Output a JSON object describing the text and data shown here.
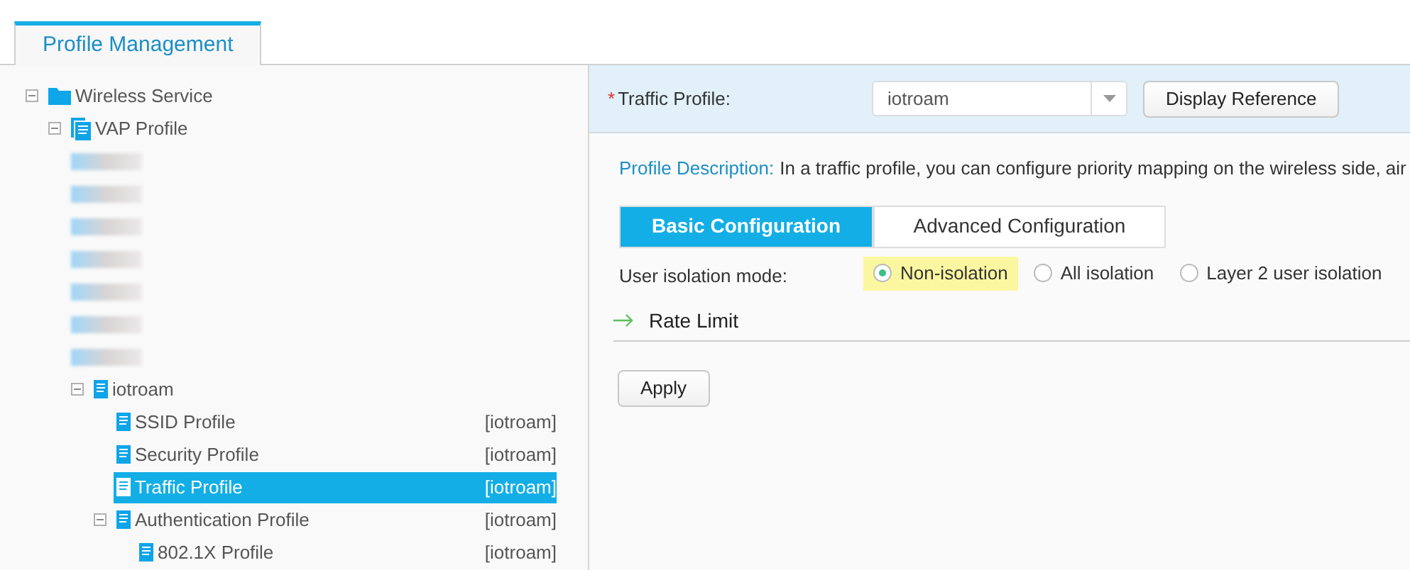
{
  "tabs": [
    {
      "label": "Profile Management",
      "selected": true
    }
  ],
  "tree": [
    {
      "label": "Wireless Service",
      "kind": "folder",
      "expanded": true,
      "selected": false,
      "children": [
        {
          "label": "VAP Profile",
          "kind": "stack",
          "expanded": true,
          "selected": false,
          "children": [
            {
              "kind": "blurred"
            },
            {
              "kind": "blurred"
            },
            {
              "kind": "blurred"
            },
            {
              "kind": "blurred"
            },
            {
              "kind": "blurred"
            },
            {
              "kind": "blurred"
            },
            {
              "kind": "blurred"
            },
            {
              "label": "iotroam",
              "kind": "doc",
              "expanded": true,
              "selected": false,
              "children": [
                {
                  "label": "SSID Profile",
                  "kind": "doc",
                  "suffix": "[iotroam]",
                  "selected": false
                },
                {
                  "label": "Security Profile",
                  "kind": "doc",
                  "suffix": "[iotroam]",
                  "selected": false
                },
                {
                  "label": "Traffic Profile",
                  "kind": "doc",
                  "suffix": "[iotroam]",
                  "selected": true
                },
                {
                  "label": "Authentication Profile",
                  "kind": "doc",
                  "suffix": "[iotroam]",
                  "expanded": true,
                  "selected": false,
                  "children": [
                    {
                      "label": "802.1X Profile",
                      "kind": "doc",
                      "suffix": "[iotroam]",
                      "selected": false
                    }
                  ]
                }
              ]
            }
          ]
        }
      ]
    }
  ],
  "profile_field": {
    "label": "Traffic Profile:",
    "required_mark": "*",
    "value": "iotroam"
  },
  "display_reference_button": "Display Reference",
  "description": {
    "label": "Profile Description:",
    "text": "In a traffic profile, you can configure priority mapping on the wireless side, air"
  },
  "config_tabs": [
    {
      "label": "Basic Configuration",
      "selected": true
    },
    {
      "label": "Advanced Configuration",
      "selected": false
    }
  ],
  "isolation": {
    "label": "User isolation mode:",
    "options": [
      {
        "label": "Non-isolation",
        "selected": true
      },
      {
        "label": "All isolation",
        "selected": false
      },
      {
        "label": "Layer 2 user isolation",
        "selected": false
      }
    ]
  },
  "section": {
    "title": "Rate Limit",
    "expanded": false
  },
  "apply_button": "Apply"
}
